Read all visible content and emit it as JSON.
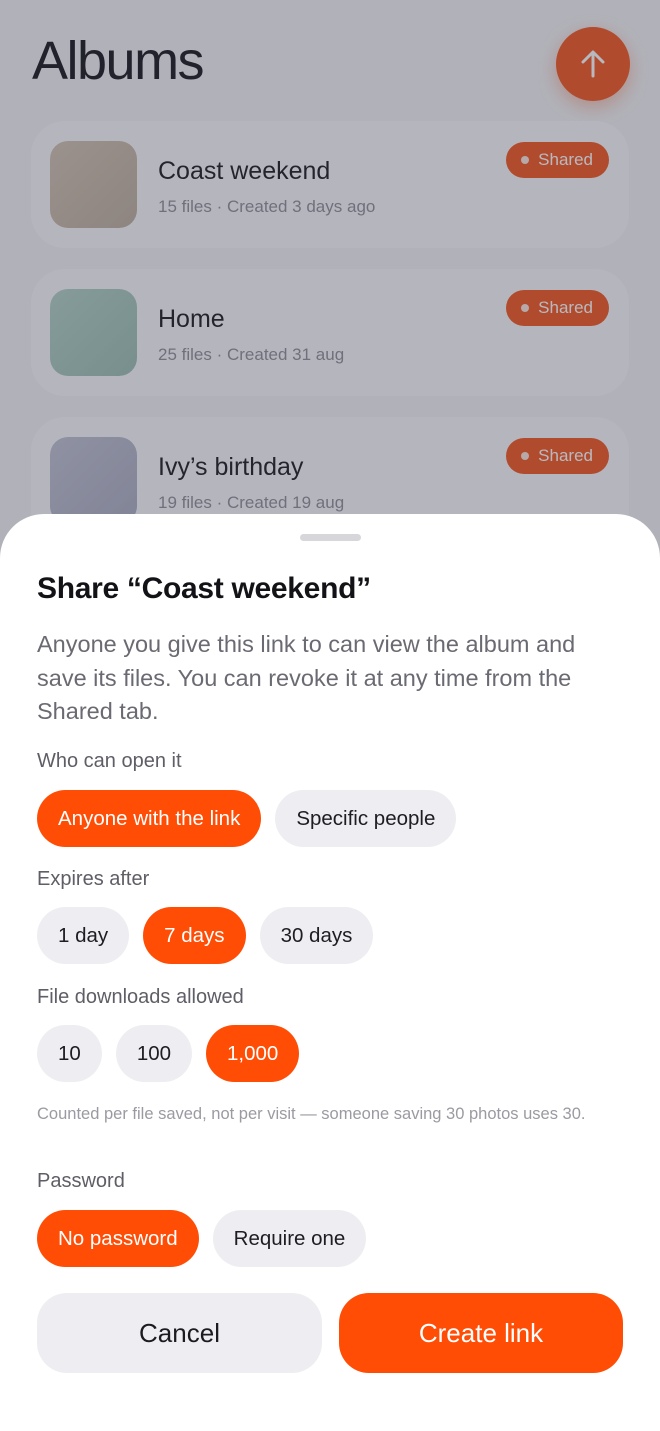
{
  "background": {
    "title": "Albums",
    "upload_icon": "arrow-up-icon",
    "albums": [
      {
        "name": "Coast weekend",
        "meta": "15 files · Created 3 days ago",
        "badge": "Shared",
        "thumb_color": "#c9b9a8"
      },
      {
        "name": "Home",
        "meta": "25 files · Created 31 aug",
        "badge": "Shared",
        "thumb_color": "#a8c8bd"
      },
      {
        "name": "Ivy’s birthday",
        "meta": "19 files · Created 19 aug",
        "badge": "Shared",
        "thumb_color": "#b7b9cb"
      }
    ]
  },
  "sheet": {
    "title": "Share “Coast weekend”",
    "description": "Anyone you give this link to can view the album and save its files. You can revoke it at any time from the Shared tab.",
    "access": {
      "label": "Who can open it",
      "options": [
        "Anyone with the link",
        "Specific people"
      ],
      "selected": "Anyone with the link"
    },
    "expiry": {
      "label": "Expires after",
      "options": [
        "1 day",
        "7 days",
        "30 days"
      ],
      "selected": "7 days"
    },
    "downloads": {
      "label": "File downloads allowed",
      "options": [
        "10",
        "100",
        "1,000"
      ],
      "selected": "1,000",
      "hint": "Counted per file saved, not per visit — someone saving 30 photos uses 30."
    },
    "password": {
      "label": "Password",
      "options": [
        "No password",
        "Require one"
      ],
      "selected": "No password"
    },
    "cancel_label": "Cancel",
    "create_label": "Create link"
  },
  "colors": {
    "accent": "#ff4d05",
    "chip_bg": "#eeeef2"
  }
}
